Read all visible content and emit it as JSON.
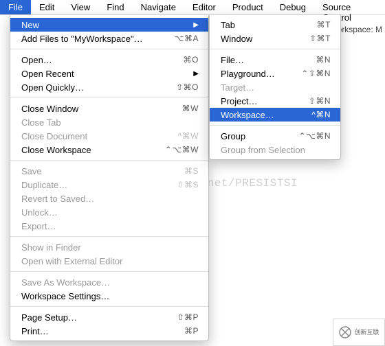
{
  "menubar": {
    "items": [
      {
        "label": "File",
        "active": true
      },
      {
        "label": "Edit"
      },
      {
        "label": "View"
      },
      {
        "label": "Find"
      },
      {
        "label": "Navigate"
      },
      {
        "label": "Editor"
      },
      {
        "label": "Product"
      },
      {
        "label": "Debug"
      },
      {
        "label": "Source Control"
      }
    ]
  },
  "background": {
    "text": "Workspace: M"
  },
  "watermark": "http://blog.csdn.net/PRESISTSI",
  "file_menu": {
    "groups": [
      [
        {
          "label": "New",
          "arrow": true,
          "hl": true
        },
        {
          "label": "Add Files to \"MyWorkspace\"…",
          "shortcut": "⌥⌘A"
        }
      ],
      [
        {
          "label": "Open…",
          "shortcut": "⌘O"
        },
        {
          "label": "Open Recent",
          "arrow": true
        },
        {
          "label": "Open Quickly…",
          "shortcut": "⇧⌘O"
        }
      ],
      [
        {
          "label": "Close Window",
          "shortcut": "⌘W"
        },
        {
          "label": "Close Tab",
          "disabled": true
        },
        {
          "label": "Close Document",
          "shortcut": "^⌘W",
          "disabled": true
        },
        {
          "label": "Close Workspace",
          "shortcut": "⌃⌥⌘W"
        }
      ],
      [
        {
          "label": "Save",
          "shortcut": "⌘S",
          "disabled": true
        },
        {
          "label": "Duplicate…",
          "shortcut": "⇧⌘S",
          "disabled": true
        },
        {
          "label": "Revert to Saved…",
          "disabled": true
        },
        {
          "label": "Unlock…",
          "disabled": true
        },
        {
          "label": "Export…",
          "disabled": true
        }
      ],
      [
        {
          "label": "Show in Finder",
          "disabled": true
        },
        {
          "label": "Open with External Editor",
          "disabled": true
        }
      ],
      [
        {
          "label": "Save As Workspace…",
          "disabled": true
        },
        {
          "label": "Workspace Settings…"
        }
      ],
      [
        {
          "label": "Page Setup…",
          "shortcut": "⇧⌘P"
        },
        {
          "label": "Print…",
          "shortcut": "⌘P"
        }
      ]
    ]
  },
  "new_submenu": {
    "groups": [
      [
        {
          "label": "Tab",
          "shortcut": "⌘T"
        },
        {
          "label": "Window",
          "shortcut": "⇧⌘T"
        }
      ],
      [
        {
          "label": "File…",
          "shortcut": "⌘N"
        },
        {
          "label": "Playground…",
          "shortcut": "⌃⇧⌘N"
        },
        {
          "label": "Target…",
          "disabled": true
        },
        {
          "label": "Project…",
          "shortcut": "⇧⌘N"
        },
        {
          "label": "Workspace…",
          "shortcut": "^⌘N",
          "hl": true
        }
      ],
      [
        {
          "label": "Group",
          "shortcut": "⌃⌥⌘N"
        },
        {
          "label": "Group from Selection",
          "disabled": true
        }
      ]
    ]
  },
  "logo": {
    "text": "创新互联"
  }
}
